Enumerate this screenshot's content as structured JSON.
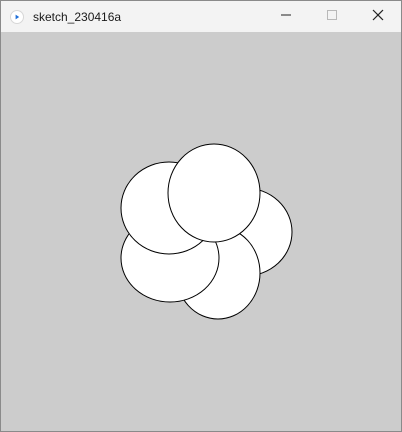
{
  "window": {
    "title": "sketch_230416a",
    "app_icon": "processing-play-icon",
    "controls": [
      "minimize-icon",
      "maximize-icon",
      "close-icon"
    ]
  },
  "canvas": {
    "background": "#cccccc",
    "shape_fill": "#ffffff",
    "shape_stroke": "#000000",
    "shape_count": 5
  }
}
